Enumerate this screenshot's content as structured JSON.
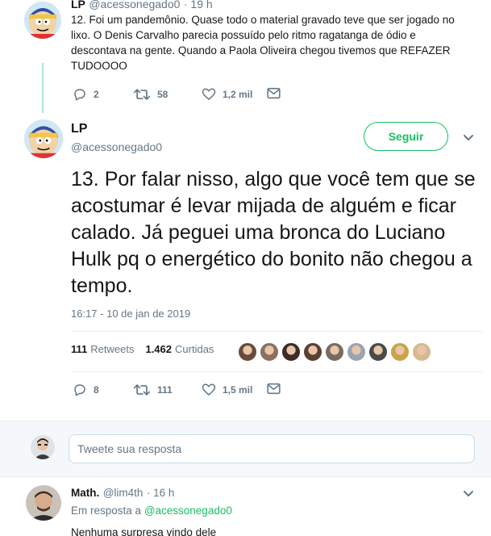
{
  "prev_tweet": {
    "name": "LP",
    "handle": "@acessonegado0",
    "time": "· 19 h",
    "text": "12. Foi um pandemônio. Quase todo o material gravado teve que ser jogado no lixo. O Denis Carvalho parecia possuído pelo ritmo ragatanga de ódio e descontava na gente. Quando a Paola Oliveira chegou tivemos que REFAZER TUDOOOO",
    "replies": "2",
    "retweets": "58",
    "likes": "1,2 mil"
  },
  "main_tweet": {
    "name": "LP",
    "handle": "@acessonegado0",
    "follow_label": "Seguir",
    "text": "13. Por falar nisso, algo que você tem que se acostumar é levar mijada de alguém e ficar calado. Já peguei uma bronca do Luciano Hulk pq o energético do bonito não chegou a tempo.",
    "timestamp": "16:17 - 10 de jan de 2019",
    "retweet_count": "111",
    "retweet_label": "Retweets",
    "like_count": "1.462",
    "like_label": "Curtidas",
    "replies": "8",
    "retweets": "111",
    "likes": "1,5 mil",
    "liker_colors": [
      "#6b4a3c",
      "#8c6f5e",
      "#3d2b24",
      "#5a4033",
      "#7a6a60",
      "#9aa3b5",
      "#4a4a4a",
      "#c9a24a",
      "#d8b890"
    ]
  },
  "reply_box": {
    "placeholder": "Tweete sua resposta"
  },
  "reply_tweet": {
    "name": "Math.",
    "handle": "@lim4th",
    "time": "· 16 h",
    "in_reply_prefix": "Em resposta a",
    "in_reply_handle": "@acessonegado0",
    "text": "Nenhuma surpresa vindo dele"
  },
  "colors": {
    "accent": "#17bf63",
    "muted": "#657786"
  }
}
